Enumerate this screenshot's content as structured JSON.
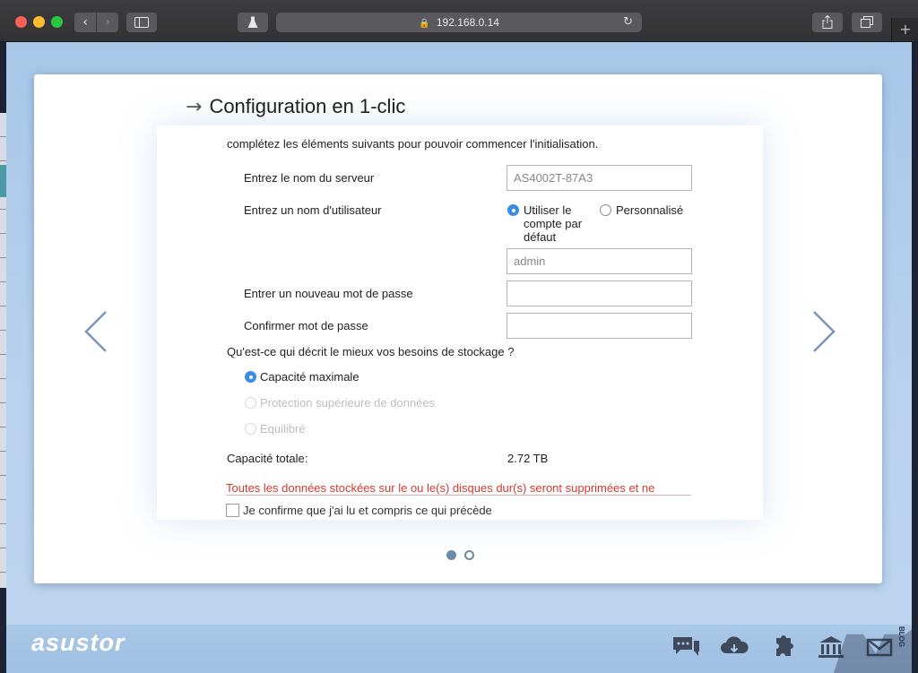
{
  "browser": {
    "url": "192.168.0.14"
  },
  "wizard": {
    "title": "Configuration en 1-clic",
    "intro": "complétez les éléments suivants pour pouvoir commencer l'initialisation.",
    "server_name": {
      "label": "Entrez le nom du serveur",
      "value": "AS4002T-87A3"
    },
    "username": {
      "label": "Entrez un nom d'utilisateur",
      "option_default": "Utiliser le compte par défaut",
      "option_custom": "Personnalisé",
      "value": "admin"
    },
    "new_password": {
      "label": "Entrer un nouveau mot de passe",
      "value": ""
    },
    "confirm_password": {
      "label": "Confirmer mot de passe",
      "value": ""
    },
    "storage": {
      "question": "Qu'est-ce qui décrit le mieux vos besoins de stockage ?",
      "options": [
        "Capacité maximale",
        "Protection supérieure de données",
        "Equilibré"
      ]
    },
    "capacity": {
      "label": "Capacité totale:",
      "value": "2.72 TB"
    },
    "warning": "Toutes les données stockées sur le ou le(s) disques dur(s) seront supprimées et ne",
    "confirm_check": "Je confirme que j'ai lu et compris ce qui précède"
  },
  "footer": {
    "brand": "asustor"
  },
  "watermark": {
    "text": "BLOG"
  },
  "colors": {
    "accent": "#3b8be8",
    "warning": "#d9382c",
    "page_bg": "#a8c7e8"
  }
}
